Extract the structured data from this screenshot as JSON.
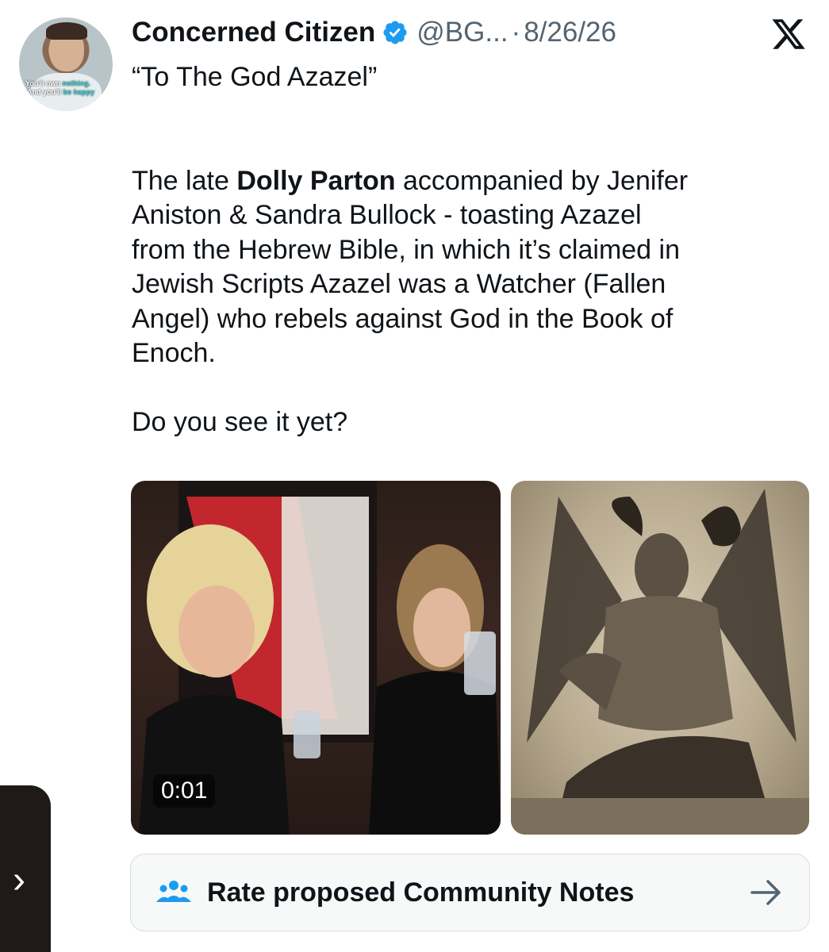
{
  "author": {
    "name": "Concerned Citizen",
    "handle": "@BG...",
    "date": "8/26/26",
    "verified": true,
    "avatar_caption_line1_a": "You'll own ",
    "avatar_caption_line1_b": "nothing.",
    "avatar_caption_line2_a": "And you'll ",
    "avatar_caption_line2_b": "be happy"
  },
  "tweet": {
    "line1": "“To The God Azazel”",
    "line2_pre": "The late ",
    "line2_bold": "Dolly Parton",
    "line2_post": " accompanied by Jenifer",
    "line3": "Aniston & Sandra Bullock - toasting Azazel",
    "line4": "from the Hebrew Bible, in which it’s claimed in",
    "line5": "Jewish Scripts Azazel was a Watcher (Fallen",
    "line6": "Angel) who rebels against God in the Book of",
    "line7": "Enoch.",
    "line8": "Do you see it yet?"
  },
  "media": {
    "video_timestamp": "0:01"
  },
  "community_notes": {
    "label": "Rate proposed Community Notes"
  },
  "icons": {
    "verified": "verified-badge-icon",
    "x_logo": "x-logo-icon",
    "notes": "people-group-icon",
    "arrow": "arrow-right-icon",
    "chevron": "chevron-right-icon"
  },
  "colors": {
    "verified_blue": "#1d9bf0",
    "notes_icon_blue": "#1d9bf0",
    "secondary_text": "#536471"
  }
}
